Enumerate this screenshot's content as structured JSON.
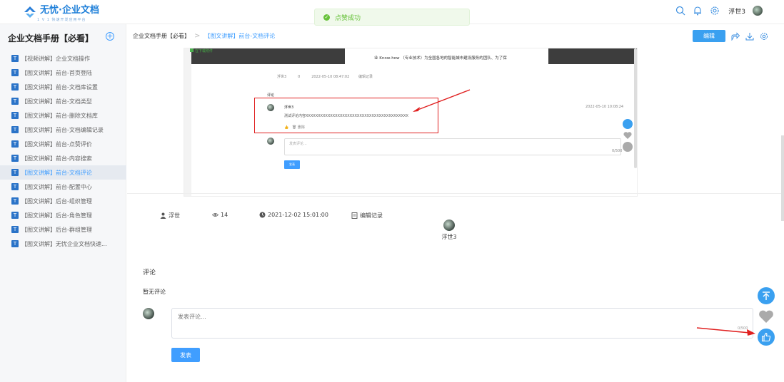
{
  "app": {
    "logo_name": "无忧·企业文档",
    "logo_sub": "1 V 1 快速开发应用平台"
  },
  "toast": {
    "text": "点赞成功"
  },
  "header": {
    "username": "浮世3"
  },
  "sidebar": {
    "title": "企业文档手册【必看】",
    "items": [
      {
        "label": "【视频讲解】企业文档操作"
      },
      {
        "label": "【图文讲解】前台-首页登陆"
      },
      {
        "label": "【图文讲解】前台-文档库设置"
      },
      {
        "label": "【图文讲解】前台-文档类型"
      },
      {
        "label": "【图文讲解】前台-删除文档库"
      },
      {
        "label": "【图文讲解】前台-文档编辑记录"
      },
      {
        "label": "【图文讲解】前台-点赞评价"
      },
      {
        "label": "【图文讲解】前台-内容搜索"
      },
      {
        "label": "【图文讲解】前台-文档评论"
      },
      {
        "label": "【图文讲解】前台-配置中心"
      },
      {
        "label": "【图文讲解】后台-组织管理"
      },
      {
        "label": "【图文讲解】后台-角色管理"
      },
      {
        "label": "【图文讲解】后台-群组管理"
      },
      {
        "label": "【图文讲解】无忧企业文档快速..."
      }
    ]
  },
  "breadcrumb": {
    "root": "企业文档手册【必看】",
    "current": "【图文讲解】前台-文档评论"
  },
  "toolbar": {
    "edit_label": "编辑"
  },
  "screenshot": {
    "line1": "业 Know-how （专业技术）为全国各地的智能城市建设服务的团队、为了保",
    "meta_author": "浮世3",
    "meta_views": "0",
    "meta_time": "2022-05-10 08:47:02",
    "meta_log": "编辑记录",
    "comment_heading": "评论",
    "commenter": "浮世3",
    "comment_time": "2022-05-10 10:08:24",
    "comment_text": "测试评论内容XXXXXXXXXXXXXXXXXXXXXXXXXXXXXXXXXXXXXXXXXX",
    "comment_delete": "删除",
    "input_placeholder": "发表评论...",
    "input_count": "0/500",
    "submit": "发表",
    "attachment": "在下载附件"
  },
  "meta": {
    "author": "浮世",
    "views": "14",
    "time": "2021-12-02 15:01:00",
    "edit_log": "编辑记录"
  },
  "likes": {
    "user": "浮世3"
  },
  "comments": {
    "title": "评论",
    "empty": "暂无评论",
    "placeholder": "发表评论...",
    "count": "0/500",
    "submit": "发表"
  },
  "colors": {
    "accent": "#409eff",
    "annotation": "#e02020",
    "success": "#67c23a"
  }
}
